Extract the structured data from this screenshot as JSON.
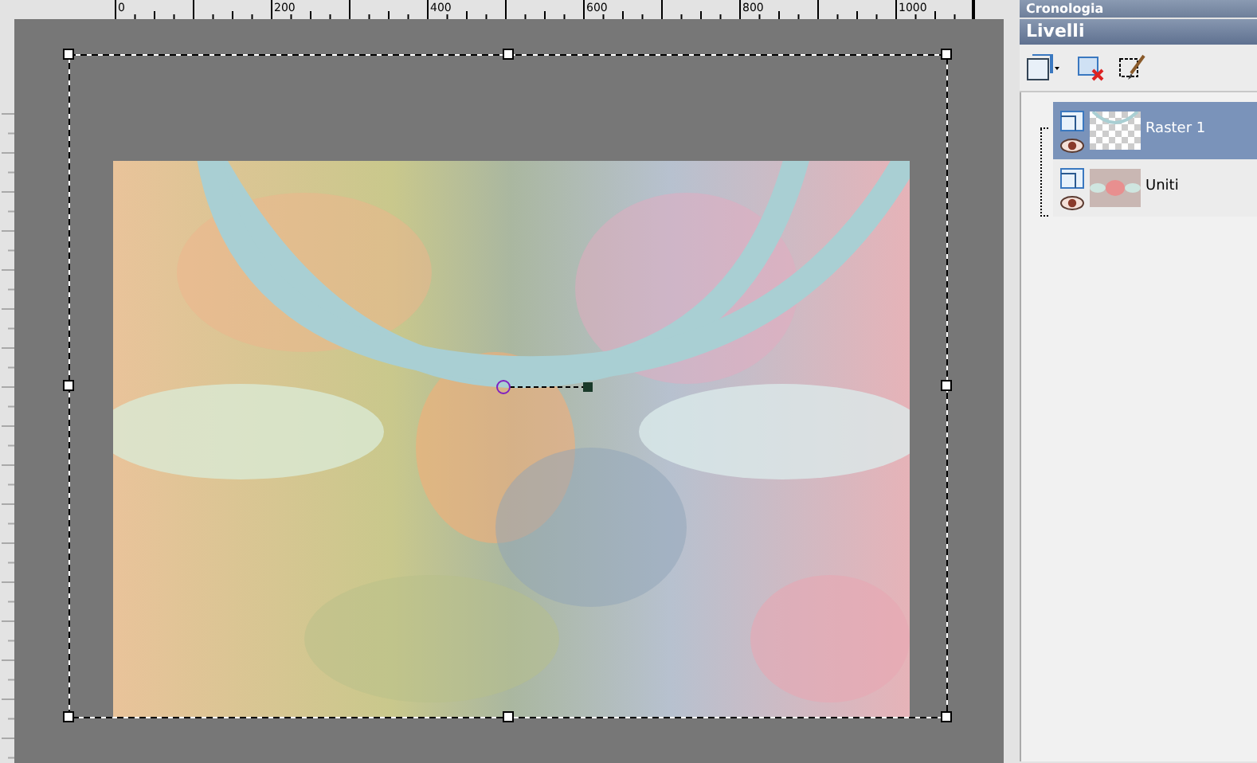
{
  "ruler": {
    "labels": [
      "0",
      "200",
      "400",
      "600",
      "800",
      "1000"
    ]
  },
  "history_panel": {
    "title": "Cronologia"
  },
  "layers_panel": {
    "title": "Livelli",
    "layers": [
      {
        "name": "Raster 1",
        "selected": true,
        "visible": true,
        "kind": "transparent"
      },
      {
        "name": "Uniti",
        "selected": false,
        "visible": true
      }
    ]
  }
}
